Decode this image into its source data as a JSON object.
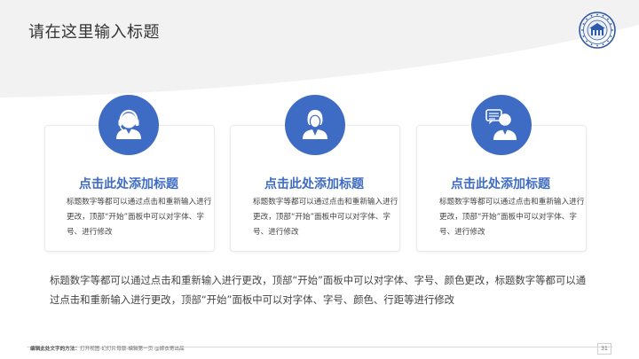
{
  "slide": {
    "title": "请在这里输入标题",
    "colors": {
      "accent": "#3e6bc3",
      "text": "#444444",
      "title": "#333333"
    },
    "cards": [
      {
        "icon": "customer-service-headset-icon",
        "heading": "点击此处添加标题",
        "body": "标题数字等都可以通过点击和重新输入进行更改，顶部“开始”面板中可以对字体、字号、进行修改"
      },
      {
        "icon": "person-avatar-icon",
        "heading": "点击此处添加标题",
        "body": "标题数字等都可以通过点击和重新输入进行更改，顶部“开始”面板中可以对字体、字号、进行修改"
      },
      {
        "icon": "person-chat-icon",
        "heading": "点击此处添加标题",
        "body": "标题数字等都可以通过点击和重新输入进行更改，顶部“开始”面板中可以对字体、字号、进行修改"
      }
    ],
    "paragraph": "标题数字等都可以通过点击和重新输入进行更改，顶部“开始”面板中可以对字体、字号、颜色更改，标题数字等都可以通过点击和重新输入进行更改，顶部“开始”面板中可以对字体、字号、颜色、行距等进行修改",
    "footer": {
      "label": "编辑此处文字的方法：",
      "text": "打开视图-幻灯片母版-编辑第一页 @嫁衣寄出品"
    },
    "page_number": "31"
  }
}
